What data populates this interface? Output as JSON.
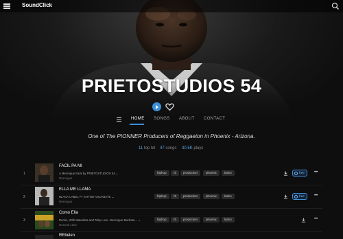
{
  "topbar": {
    "brand": "SoundClick"
  },
  "hero": {
    "artist_name": "PRIETOSTUDIOS 54"
  },
  "nav": {
    "items": [
      {
        "label": "HOME",
        "active": true
      },
      {
        "label": "SONGS",
        "active": false
      },
      {
        "label": "ABOUT",
        "active": false
      },
      {
        "label": "CONTACT",
        "active": false
      }
    ]
  },
  "tagline": "One of The PIONNER Producers of Reggaeton in Phoenix - Arizona.",
  "stats": {
    "top_hit_num": "11",
    "top_hit_label": "top hit",
    "songs_num": "47",
    "songs_label": "songs",
    "plays_num": "30.5K",
    "plays_label": "plays"
  },
  "tracks": [
    {
      "index": "1",
      "title": "FACIL PA MI",
      "subtitle": "A Merengue track by PRIETOSTUDIOS 54",
      "genre": "Merengue",
      "tags": [
        "hiphop",
        "rb",
        "production",
        "phoenix",
        "latino"
      ],
      "free_label": "free"
    },
    {
      "index": "2",
      "title": "ELLA ME LLAMA",
      "subtitle": "BLACK LABEL FT SHYNO AGUABATE",
      "genre": "Merengue",
      "tags": [
        "hiphop",
        "rb",
        "production",
        "phoenix",
        "latino"
      ],
      "free_label": "free"
    },
    {
      "index": "3",
      "title": "Como Ella",
      "subtitle": "Remix, With Makalista and Toby Love. Merengue Bachata...",
      "genre": "General Latin",
      "tags": [
        "hiphop",
        "rb",
        "production",
        "phoenix",
        "latino"
      ]
    },
    {
      "index": "4",
      "title": "REbelen"
    }
  ],
  "colors": {
    "accent": "#3d8fd6",
    "background": "#0e0e0e"
  }
}
